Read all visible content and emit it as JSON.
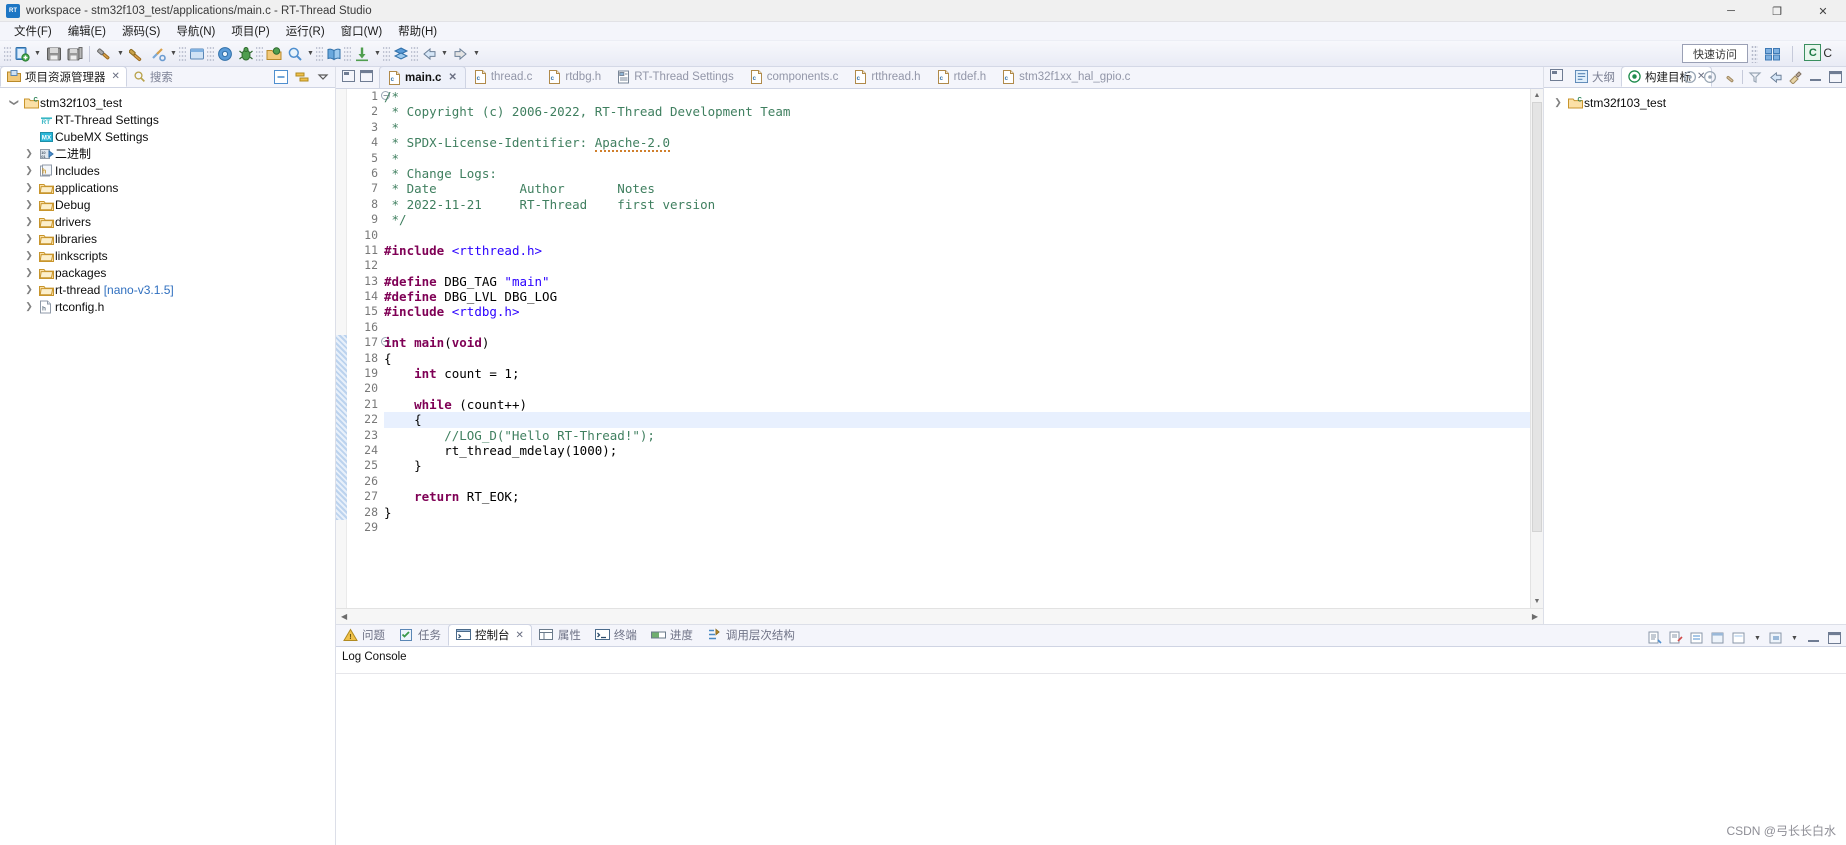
{
  "window": {
    "title": "workspace - stm32f103_test/applications/main.c - RT-Thread Studio",
    "app_icon": "rt-thread-icon",
    "minimize": "─",
    "maximize": "❐",
    "close": "✕"
  },
  "menubar": {
    "items": [
      {
        "label": "文件(F)",
        "name": "menu-file"
      },
      {
        "label": "编辑(E)",
        "name": "menu-edit"
      },
      {
        "label": "源码(S)",
        "name": "menu-source"
      },
      {
        "label": "导航(N)",
        "name": "menu-navigate"
      },
      {
        "label": "项目(P)",
        "name": "menu-project"
      },
      {
        "label": "运行(R)",
        "name": "menu-run"
      },
      {
        "label": "窗口(W)",
        "name": "menu-window"
      },
      {
        "label": "帮助(H)",
        "name": "menu-help"
      }
    ]
  },
  "toolbar": {
    "quick_access": "快速访问",
    "perspective_c_label": "C",
    "perspective_c_letter": "C"
  },
  "project_explorer": {
    "tabs": [
      {
        "label": "项目资源管理器",
        "active": true,
        "closable": true
      },
      {
        "label": "搜索",
        "active": false,
        "closable": false
      }
    ],
    "tree": [
      {
        "label": "stm32f103_test",
        "depth": 0,
        "twisty": "open",
        "icon": "project-c-icon"
      },
      {
        "label": "RT-Thread Settings",
        "depth": 1,
        "twisty": "none",
        "icon": "rt-settings-icon"
      },
      {
        "label": "CubeMX Settings",
        "depth": 1,
        "twisty": "none",
        "icon": "mx-settings-icon"
      },
      {
        "label": "二进制",
        "depth": 1,
        "twisty": "closed",
        "icon": "binaries-icon"
      },
      {
        "label": "Includes",
        "depth": 1,
        "twisty": "closed",
        "icon": "includes-icon"
      },
      {
        "label": "applications",
        "depth": 1,
        "twisty": "closed",
        "icon": "folder-icon"
      },
      {
        "label": "Debug",
        "depth": 1,
        "twisty": "closed",
        "icon": "folder-icon"
      },
      {
        "label": "drivers",
        "depth": 1,
        "twisty": "closed",
        "icon": "folder-icon"
      },
      {
        "label": "libraries",
        "depth": 1,
        "twisty": "closed",
        "icon": "folder-icon"
      },
      {
        "label": "linkscripts",
        "depth": 1,
        "twisty": "closed",
        "icon": "folder-icon"
      },
      {
        "label": "packages",
        "depth": 1,
        "twisty": "closed",
        "icon": "folder-icon"
      },
      {
        "label": "rt-thread",
        "suffix": " [nano-v3.1.5]",
        "depth": 1,
        "twisty": "closed",
        "icon": "folder-icon"
      },
      {
        "label": "rtconfig.h",
        "depth": 1,
        "twisty": "closed",
        "icon": "header-file-icon"
      }
    ]
  },
  "editor": {
    "tabs": [
      {
        "label": "main.c",
        "active": true,
        "icon": "c-file-icon",
        "closable": true
      },
      {
        "label": "thread.c",
        "active": false,
        "icon": "c-file-icon",
        "closable": false
      },
      {
        "label": "rtdbg.h",
        "active": false,
        "icon": "c-file-icon",
        "closable": false
      },
      {
        "label": "RT-Thread Settings",
        "active": false,
        "icon": "settings-file-icon",
        "closable": false
      },
      {
        "label": "components.c",
        "active": false,
        "icon": "c-file-icon",
        "closable": false
      },
      {
        "label": "rtthread.h",
        "active": false,
        "icon": "c-file-icon",
        "closable": false
      },
      {
        "label": "rtdef.h",
        "active": false,
        "icon": "c-file-icon",
        "closable": false
      },
      {
        "label": "stm32f1xx_hal_gpio.c",
        "active": false,
        "icon": "c-file-icon",
        "closable": false
      }
    ],
    "first_line": 1,
    "last_line": 29,
    "highlighted_line": 22,
    "code": [
      {
        "n": 1,
        "fold": "collapse",
        "tokens": [
          {
            "t": "/*",
            "c": "cmt"
          }
        ]
      },
      {
        "n": 2,
        "tokens": [
          {
            "t": " * Copyright (c) 2006-2022, RT-Thread Development Team",
            "c": "cmt"
          }
        ]
      },
      {
        "n": 3,
        "tokens": [
          {
            "t": " *",
            "c": "cmt"
          }
        ]
      },
      {
        "n": 4,
        "tokens": [
          {
            "t": " * SPDX-License-Identifier: ",
            "c": "cmt"
          },
          {
            "t": "Apache-2.0",
            "c": "cmt spell"
          }
        ]
      },
      {
        "n": 5,
        "tokens": [
          {
            "t": " *",
            "c": "cmt"
          }
        ]
      },
      {
        "n": 6,
        "tokens": [
          {
            "t": " * Change Logs:",
            "c": "cmt"
          }
        ]
      },
      {
        "n": 7,
        "tokens": [
          {
            "t": " * Date           Author       Notes",
            "c": "cmt"
          }
        ]
      },
      {
        "n": 8,
        "tokens": [
          {
            "t": " * 2022-11-21     RT-Thread    first version",
            "c": "cmt"
          }
        ]
      },
      {
        "n": 9,
        "tokens": [
          {
            "t": " */",
            "c": "cmt"
          }
        ]
      },
      {
        "n": 10,
        "tokens": []
      },
      {
        "n": 11,
        "tokens": [
          {
            "t": "#include",
            "c": "pp"
          },
          {
            "t": " ",
            "c": ""
          },
          {
            "t": "<rtthread.h>",
            "c": "inc"
          }
        ]
      },
      {
        "n": 12,
        "tokens": []
      },
      {
        "n": 13,
        "tokens": [
          {
            "t": "#define",
            "c": "pp"
          },
          {
            "t": " DBG_TAG ",
            "c": ""
          },
          {
            "t": "\"main\"",
            "c": "str"
          }
        ]
      },
      {
        "n": 14,
        "tokens": [
          {
            "t": "#define",
            "c": "pp"
          },
          {
            "t": " DBG_LVL DBG_LOG",
            "c": ""
          }
        ]
      },
      {
        "n": 15,
        "tokens": [
          {
            "t": "#include",
            "c": "pp"
          },
          {
            "t": " ",
            "c": ""
          },
          {
            "t": "<rtdbg.h>",
            "c": "inc"
          }
        ]
      },
      {
        "n": 16,
        "tokens": []
      },
      {
        "n": 17,
        "fold": "collapse",
        "tokens": [
          {
            "t": "int",
            "c": "kw"
          },
          {
            "t": " ",
            "c": ""
          },
          {
            "t": "main",
            "c": "kw"
          },
          {
            "t": "(",
            "c": ""
          },
          {
            "t": "void",
            "c": "kw"
          },
          {
            "t": ")",
            "c": ""
          }
        ]
      },
      {
        "n": 18,
        "tokens": [
          {
            "t": "{",
            "c": ""
          }
        ]
      },
      {
        "n": 19,
        "tokens": [
          {
            "t": "    ",
            "c": ""
          },
          {
            "t": "int",
            "c": "kw"
          },
          {
            "t": " count = 1;",
            "c": ""
          }
        ]
      },
      {
        "n": 20,
        "tokens": []
      },
      {
        "n": 21,
        "tokens": [
          {
            "t": "    ",
            "c": ""
          },
          {
            "t": "while",
            "c": "kw"
          },
          {
            "t": " (count++)",
            "c": ""
          }
        ]
      },
      {
        "n": 22,
        "tokens": [
          {
            "t": "    {",
            "c": ""
          }
        ]
      },
      {
        "n": 23,
        "tokens": [
          {
            "t": "        //LOG_D(\"Hello RT-Thread!\");",
            "c": "cmt"
          }
        ]
      },
      {
        "n": 24,
        "tokens": [
          {
            "t": "        rt_thread_mdelay(1000);",
            "c": ""
          }
        ]
      },
      {
        "n": 25,
        "tokens": [
          {
            "t": "    }",
            "c": ""
          }
        ]
      },
      {
        "n": 26,
        "tokens": []
      },
      {
        "n": 27,
        "tokens": [
          {
            "t": "    ",
            "c": ""
          },
          {
            "t": "return",
            "c": "kw"
          },
          {
            "t": " RT_EOK;",
            "c": ""
          }
        ]
      },
      {
        "n": 28,
        "tokens": [
          {
            "t": "}",
            "c": ""
          }
        ]
      },
      {
        "n": 29,
        "tokens": []
      }
    ]
  },
  "right_panel": {
    "tabs": [
      {
        "label": "大纲",
        "active": false,
        "icon": "outline-icon",
        "closable": false
      },
      {
        "label": "构建目标",
        "active": true,
        "icon": "build-target-icon",
        "closable": true
      }
    ],
    "tree": [
      {
        "label": "stm32f103_test",
        "depth": 0,
        "twisty": "closed",
        "icon": "project-c-icon"
      }
    ]
  },
  "bottom_panel": {
    "tabs": [
      {
        "label": "问题",
        "active": false,
        "icon": "problems-icon",
        "closable": false
      },
      {
        "label": "任务",
        "active": false,
        "icon": "tasks-icon",
        "closable": false
      },
      {
        "label": "控制台",
        "active": true,
        "icon": "console-icon",
        "closable": true
      },
      {
        "label": "属性",
        "active": false,
        "icon": "properties-icon",
        "closable": false
      },
      {
        "label": "终端",
        "active": false,
        "icon": "terminal-icon",
        "closable": false
      },
      {
        "label": "进度",
        "active": false,
        "icon": "progress-icon",
        "closable": false
      },
      {
        "label": "调用层次结构",
        "active": false,
        "icon": "call-hierarchy-icon",
        "closable": false
      }
    ],
    "console_title": "Log Console"
  },
  "watermark": "CSDN @弓长长白水",
  "colors": {
    "accent": "#1d76c4",
    "comment": "#3f7f5f",
    "keyword": "#7f0055",
    "string": "#2a00ff",
    "selection": "#e8f0fe",
    "panel_bg": "#f4f5fb"
  }
}
